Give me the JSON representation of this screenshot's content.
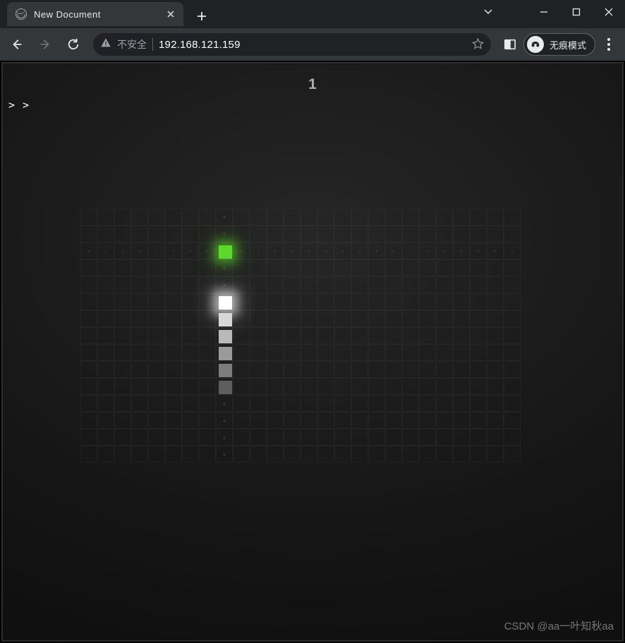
{
  "window": {
    "dropdown_icon": "chevron-down",
    "minimize": "—",
    "maximize": "□",
    "close": "×"
  },
  "tab": {
    "title": "New Document",
    "close_aria": "Close tab"
  },
  "newtab": {
    "aria": "New tab"
  },
  "nav": {
    "back": "Back",
    "forward": "Forward",
    "reload": "Reload"
  },
  "omnibox": {
    "insecure_label": "不安全",
    "url": "192.168.121.159",
    "star_aria": "Bookmark this page"
  },
  "right": {
    "panel_aria": "Side panel",
    "incognito_label": "无痕模式",
    "menu_aria": "Customize and control"
  },
  "game": {
    "score": "1",
    "prompt": "> >",
    "grid": {
      "cols": 26,
      "rows": 15
    },
    "food": {
      "col": 8,
      "row": 2
    },
    "snake": {
      "head": {
        "col": 8,
        "row": 5
      },
      "body": [
        {
          "col": 8,
          "row": 6,
          "shade": "#d8d8d8"
        },
        {
          "col": 8,
          "row": 7,
          "shade": "#b9b9b9"
        },
        {
          "col": 8,
          "row": 8,
          "shade": "#9a9a9a"
        },
        {
          "col": 8,
          "row": 9,
          "shade": "#7c7c7c"
        },
        {
          "col": 8,
          "row": 10,
          "shade": "#5e5e5e"
        }
      ]
    }
  },
  "watermark": "CSDN @aa一叶知秋aa"
}
